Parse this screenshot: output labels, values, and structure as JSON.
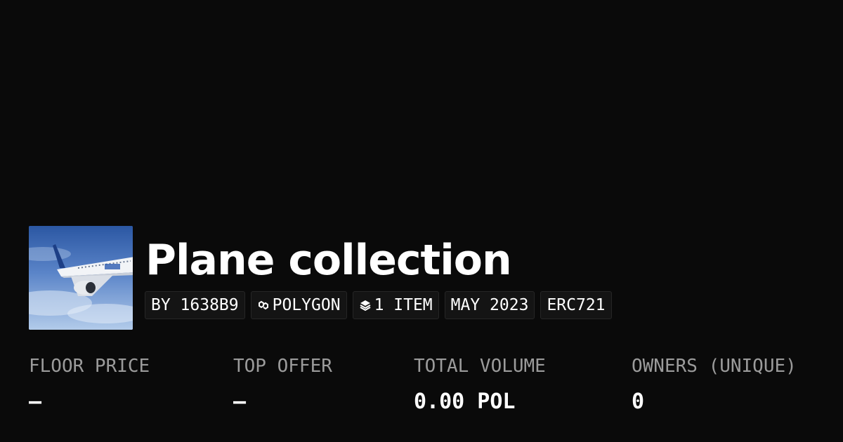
{
  "collection": {
    "title": "Plane collection",
    "chips": {
      "creator": "BY 1638B9",
      "chain": "POLYGON",
      "items": "1 ITEM",
      "date": "MAY 2023",
      "standard": "ERC721"
    },
    "thumbnail_icon": "airplane-image"
  },
  "stats": [
    {
      "label": "FLOOR PRICE",
      "value": "–"
    },
    {
      "label": "TOP OFFER",
      "value": "–"
    },
    {
      "label": "TOTAL VOLUME",
      "value": "0.00 POL"
    },
    {
      "label": "OWNERS (UNIQUE)",
      "value": "0"
    }
  ],
  "colors": {
    "background": "#0a0a0a",
    "text": "#ffffff",
    "muted": "#9b9b9b",
    "chip_bg": "#141414"
  }
}
